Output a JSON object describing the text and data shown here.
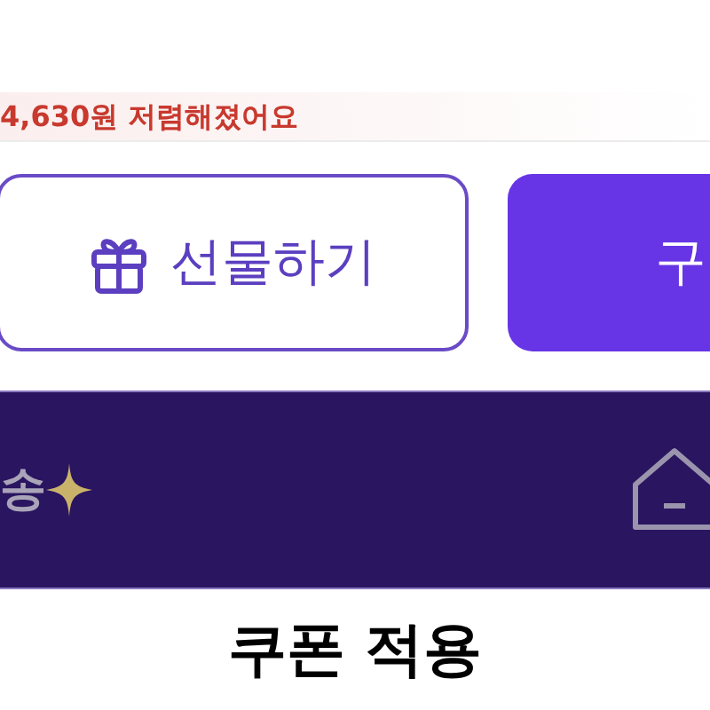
{
  "price_notice": "4,630원 저렴해졌어요",
  "buttons": [
    {
      "kind": "outline",
      "label": "선물하기"
    },
    {
      "kind": "filled",
      "label": "구"
    }
  ],
  "banner": {
    "text": "송"
  },
  "title": "쿠폰 적용"
}
